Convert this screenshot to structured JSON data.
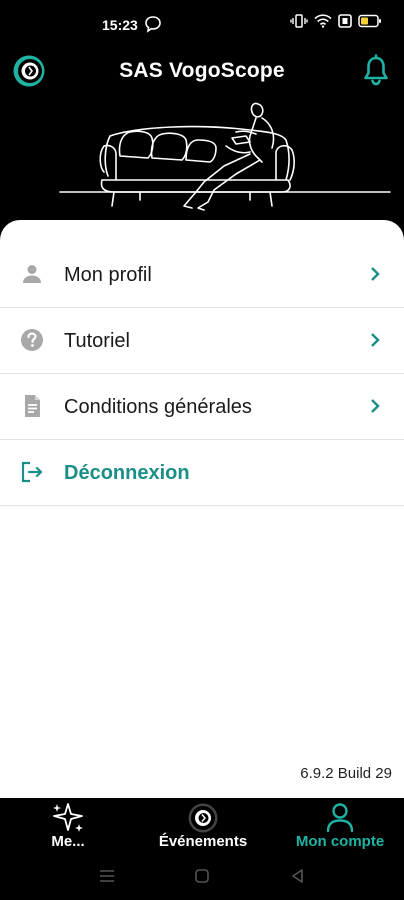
{
  "status_bar": {
    "time": "15:23",
    "icons": [
      "chat-bubble-icon",
      "vibrate-icon",
      "wifi-icon",
      "sim-icon",
      "battery-icon"
    ]
  },
  "header": {
    "title": "SAS VogoScope",
    "logo_icon": "vogoscope-logo-icon",
    "notification_icon": "bell-icon"
  },
  "menu": {
    "items": [
      {
        "label": "Mon profil",
        "icon": "person-icon"
      },
      {
        "label": "Tutoriel",
        "icon": "help-circle-icon"
      },
      {
        "label": "Conditions générales",
        "icon": "document-icon"
      }
    ],
    "logout_label": "Déconnexion"
  },
  "version": "6.9.2 Build 29",
  "bottom_nav": {
    "tabs": [
      {
        "label": "Me...",
        "icon": "sparkle-icon"
      },
      {
        "label": "Événements",
        "icon": "vogoscope-logo-icon"
      },
      {
        "label": "Mon compte",
        "icon": "account-icon",
        "active": true
      }
    ]
  },
  "colors": {
    "accent": "#1fb3a4",
    "accent_dark": "#1a8f86",
    "background": "#000000",
    "card": "#ffffff"
  }
}
